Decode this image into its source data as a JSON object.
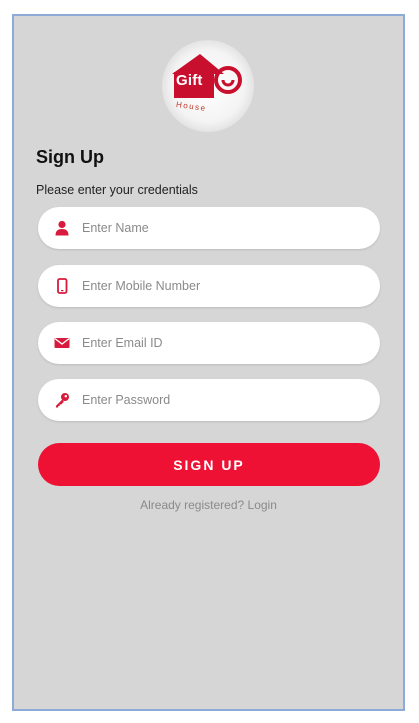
{
  "brand": {
    "logo_word": "Gift",
    "logo_sub": "House",
    "accent_color": "#ee1133"
  },
  "header": {
    "title": "Sign Up",
    "subtitle": "Please enter your credentials"
  },
  "form": {
    "fields": [
      {
        "icon": "user-icon",
        "placeholder": "Enter Name",
        "value": ""
      },
      {
        "icon": "mobile-phone-icon",
        "placeholder": "Enter Mobile Number",
        "value": ""
      },
      {
        "icon": "envelope-icon",
        "placeholder": "Enter Email ID",
        "value": ""
      },
      {
        "icon": "key-icon",
        "placeholder": "Enter Password",
        "value": ""
      }
    ],
    "submit_label": "SIGN UP"
  },
  "footer": {
    "prompt": "Already registered?",
    "login_label": "Login"
  }
}
